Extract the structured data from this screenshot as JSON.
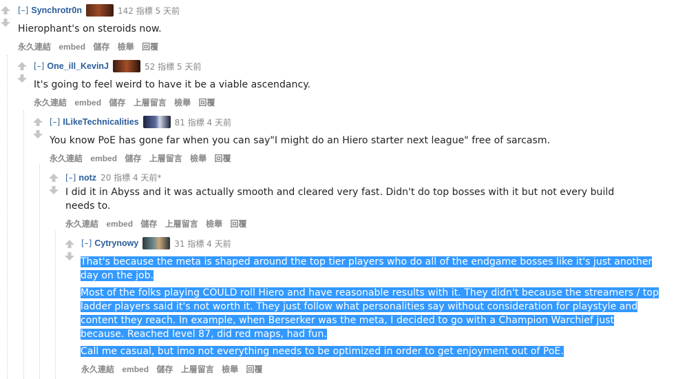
{
  "comments": [
    {
      "collapse": "[–]",
      "author": "Synchrotr0n",
      "meta": "142 指標 5 天前",
      "paragraphs": [
        "Hierophant's on steroids now."
      ],
      "buttons": [
        "永久連結",
        "embed",
        "儲存",
        "檢舉",
        "回覆"
      ]
    },
    {
      "collapse": "[–]",
      "author": "One_ill_KevinJ",
      "meta": "52 指標 5 天前",
      "paragraphs": [
        "It's going to feel weird to have it be a viable ascendancy."
      ],
      "buttons": [
        "永久連結",
        "embed",
        "儲存",
        "上層留言",
        "檢舉",
        "回覆"
      ]
    },
    {
      "collapse": "[–]",
      "author": "ILikeTechnicalities",
      "meta": "81 指標 4 天前",
      "paragraphs": [
        "You know PoE has gone far when you can say\"I might do an Hiero starter next league\" free of sarcasm."
      ],
      "buttons": [
        "永久連結",
        "embed",
        "儲存",
        "上層留言",
        "檢舉",
        "回覆"
      ]
    },
    {
      "collapse": "[–]",
      "author": "notz",
      "meta": "20 指標 4 天前*",
      "paragraphs": [
        "I did it in Abyss and it was actually smooth and cleared very fast. Didn't do top bosses with it but not every build needs to."
      ],
      "buttons": [
        "永久連結",
        "embed",
        "儲存",
        "上層留言",
        "檢舉",
        "回覆"
      ]
    },
    {
      "collapse": "[–]",
      "author": "Cytrynowy",
      "meta": "31 指標 4 天前",
      "paragraphs": [
        "That's because the meta is shaped around the top tier players who do all of the endgame bosses like it's just another day on the job.",
        "Most of the folks playing COULD roll Hiero and have reasonable results with it. They didn't because the streamers / top ladder players said it's not worth it. They just follow what personalities say without consideration for playstyle and content they reach. In example, when Berserker was the meta, I decided to go with a Champion Warchief just because. Reached level 87, did red maps, had fun.",
        "Call me casual, but imo not everything needs to be optimized in order to get enjoyment out of PoE."
      ],
      "buttons": [
        "永久連結",
        "embed",
        "儲存",
        "上層留言",
        "檢舉",
        "回覆"
      ]
    }
  ],
  "colors": {
    "author": "#2a5d9a",
    "meta": "#888888",
    "selection": "#3399ff",
    "arrow": "#c6c6c6"
  },
  "icons": {
    "upvote": "upvote-arrow-icon",
    "downvote": "downvote-arrow-icon"
  }
}
